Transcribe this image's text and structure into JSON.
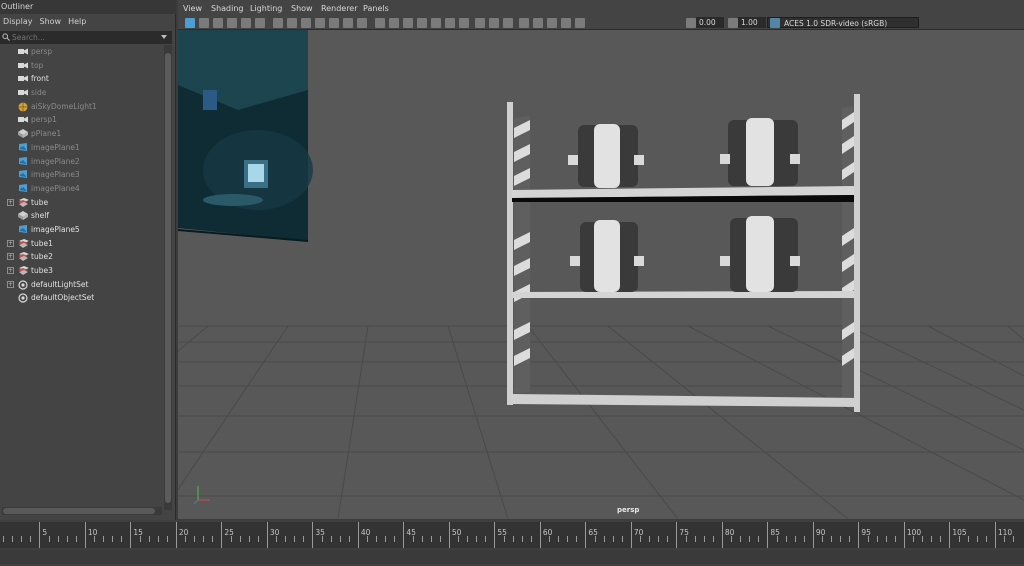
{
  "outliner": {
    "title": "Outliner",
    "menu": [
      "Display",
      "Show",
      "Help"
    ],
    "search_placeholder": "Search...",
    "items": [
      {
        "label": "persp",
        "icon": "camera-icon",
        "state": "dim",
        "expandable": false
      },
      {
        "label": "top",
        "icon": "camera-icon",
        "state": "dim",
        "expandable": false
      },
      {
        "label": "front",
        "icon": "camera-icon",
        "state": "bright",
        "expandable": false
      },
      {
        "label": "side",
        "icon": "camera-icon",
        "state": "dim",
        "expandable": false
      },
      {
        "label": "aiSkyDomeLight1",
        "icon": "skydome-light-icon",
        "state": "dim",
        "expandable": false
      },
      {
        "label": "persp1",
        "icon": "camera-icon",
        "state": "dim",
        "expandable": false
      },
      {
        "label": "pPlane1",
        "icon": "mesh-icon",
        "state": "dim",
        "expandable": false
      },
      {
        "label": "imagePlane1",
        "icon": "image-plane-icon",
        "state": "dim",
        "expandable": false
      },
      {
        "label": "imagePlane2",
        "icon": "image-plane-icon",
        "state": "dim",
        "expandable": false
      },
      {
        "label": "imagePlane3",
        "icon": "image-plane-icon",
        "state": "dim",
        "expandable": false
      },
      {
        "label": "imagePlane4",
        "icon": "image-plane-icon",
        "state": "dim",
        "expandable": false
      },
      {
        "label": "tube",
        "icon": "group-icon",
        "state": "bright",
        "expandable": true
      },
      {
        "label": "shelf",
        "icon": "mesh-icon",
        "state": "bright",
        "expandable": false
      },
      {
        "label": "imagePlane5",
        "icon": "image-plane-icon",
        "state": "bright",
        "expandable": false
      },
      {
        "label": "tube1",
        "icon": "group-icon",
        "state": "bright",
        "expandable": true
      },
      {
        "label": "tube2",
        "icon": "group-icon",
        "state": "bright",
        "expandable": true
      },
      {
        "label": "tube3",
        "icon": "group-icon",
        "state": "bright",
        "expandable": true
      },
      {
        "label": "defaultLightSet",
        "icon": "set-icon",
        "state": "bright",
        "expandable": true
      },
      {
        "label": "defaultObjectSet",
        "icon": "set-icon",
        "state": "bright",
        "expandable": false
      }
    ]
  },
  "viewport": {
    "menu": [
      "View",
      "Shading",
      "Lighting",
      "Show",
      "Renderer",
      "Panels"
    ],
    "exposure": "0.00",
    "gamma": "1.00",
    "color_space": "ACES 1.0 SDR-video (sRGB)",
    "camera_label": "persp",
    "axis_labels": {
      "y": "y",
      "x": "x"
    }
  },
  "timeline": {
    "ticks": [
      "5",
      "10",
      "15",
      "20",
      "25",
      "30",
      "35",
      "40",
      "45",
      "50",
      "55",
      "60",
      "65",
      "70",
      "75",
      "80",
      "85",
      "90",
      "95",
      "100",
      "105",
      "110"
    ]
  },
  "colors": {
    "accent": "#5285a6",
    "icon_blue": "#4d9ed3",
    "icon_red": "#c94f4f",
    "icon_yellow": "#d6a33a"
  }
}
